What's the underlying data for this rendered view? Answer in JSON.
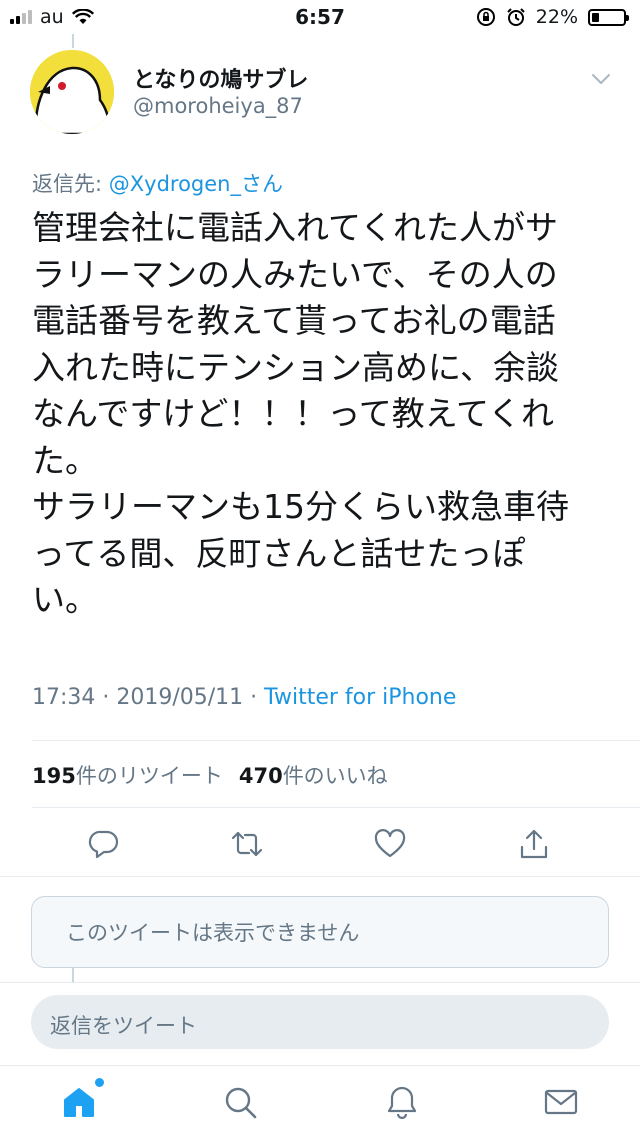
{
  "status_bar": {
    "carrier": "au",
    "time": "6:57",
    "battery": "22%",
    "battery_level": 0.22
  },
  "tweet": {
    "author_name": "となりの鳩サブレ",
    "author_handle": "@moroheiya_87",
    "reply_prefix": "返信先: ",
    "reply_mention": "@Xydrogen_さん",
    "text": "管理会社に電話入れてくれた人がサ\nラリーマンの人みたいで、その人の\n電話番号を教えて貰ってお礼の電話\n入れた時にテンション高めに、余談\nなんですけど！！！って教えてくれ\nた。\nサラリーマンも15分くらい救急車待\nってる間、反町さんと話せたっぽ\nい。",
    "timestamp": "17:34 · 2019/05/11 · ",
    "source": "Twitter for iPhone",
    "retweet_count": "195",
    "retweet_label": "件のリツイート",
    "like_count": "470",
    "like_label": "件のいいね"
  },
  "actions": {
    "reply_icon": "reply-icon",
    "retweet_icon": "retweet-icon",
    "like_icon": "heart-icon",
    "share_icon": "share-icon"
  },
  "quoted_tweet": {
    "unavailable_text": "このツイートは表示できません"
  },
  "reply_box": {
    "placeholder": "返信をツイート"
  },
  "tab_bar": {
    "items": [
      "home-icon",
      "search-icon",
      "notifications-icon",
      "messages-icon"
    ],
    "active": "home-icon"
  },
  "colors": {
    "accent": "#1da1f2",
    "link": "#1b95e0",
    "secondary_text": "#657786",
    "icon_gray": "#657786",
    "avatar_yellow": "#f2df3b"
  }
}
